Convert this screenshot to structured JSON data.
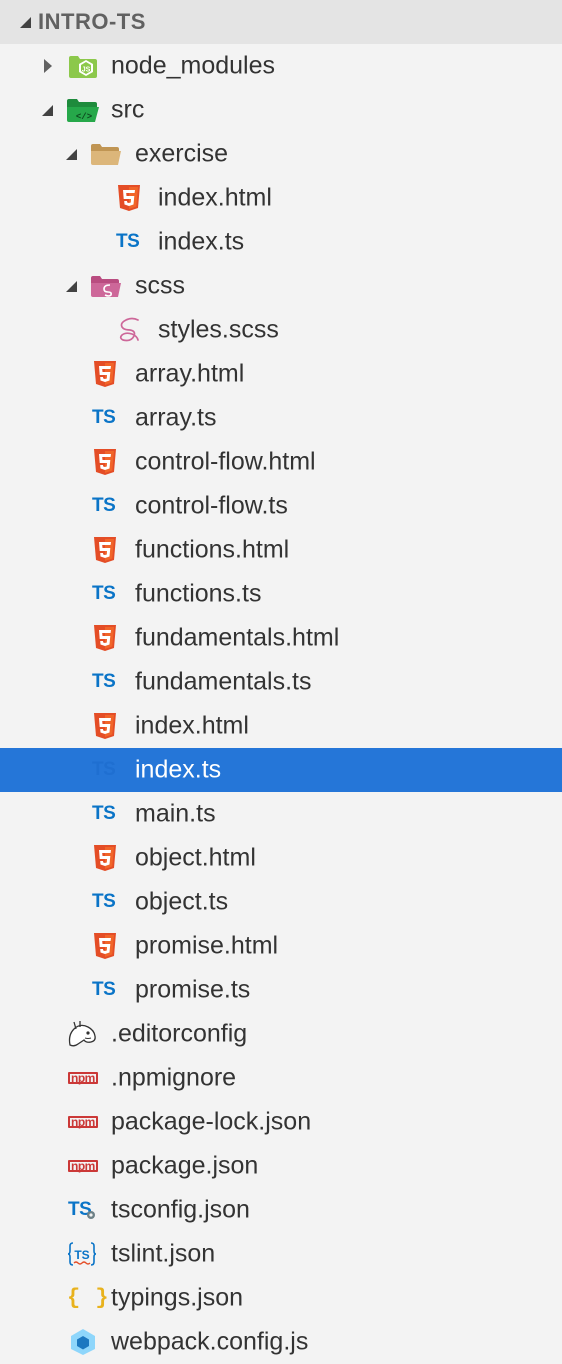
{
  "explorer": {
    "section_title": "INTRO-TS",
    "items": [
      {
        "label": "node_modules",
        "icon": "node-folder-icon",
        "type": "folder",
        "expanded": false
      },
      {
        "label": "src",
        "icon": "src-folder-icon",
        "type": "folder",
        "expanded": true
      },
      {
        "label": "exercise",
        "icon": "folder-open-icon",
        "type": "folder",
        "expanded": true
      },
      {
        "label": "index.html",
        "icon": "html5-icon",
        "type": "file"
      },
      {
        "label": "index.ts",
        "icon": "typescript-icon",
        "type": "file"
      },
      {
        "label": "scss",
        "icon": "sass-folder-icon",
        "type": "folder",
        "expanded": true
      },
      {
        "label": "styles.scss",
        "icon": "sass-icon",
        "type": "file"
      },
      {
        "label": "array.html",
        "icon": "html5-icon",
        "type": "file"
      },
      {
        "label": "array.ts",
        "icon": "typescript-icon",
        "type": "file"
      },
      {
        "label": "control-flow.html",
        "icon": "html5-icon",
        "type": "file"
      },
      {
        "label": "control-flow.ts",
        "icon": "typescript-icon",
        "type": "file"
      },
      {
        "label": "functions.html",
        "icon": "html5-icon",
        "type": "file"
      },
      {
        "label": "functions.ts",
        "icon": "typescript-icon",
        "type": "file"
      },
      {
        "label": "fundamentals.html",
        "icon": "html5-icon",
        "type": "file"
      },
      {
        "label": "fundamentals.ts",
        "icon": "typescript-icon",
        "type": "file"
      },
      {
        "label": "index.html",
        "icon": "html5-icon",
        "type": "file"
      },
      {
        "label": "index.ts",
        "icon": "typescript-icon",
        "type": "file",
        "selected": true
      },
      {
        "label": "main.ts",
        "icon": "typescript-icon",
        "type": "file"
      },
      {
        "label": "object.html",
        "icon": "html5-icon",
        "type": "file"
      },
      {
        "label": "object.ts",
        "icon": "typescript-icon",
        "type": "file"
      },
      {
        "label": "promise.html",
        "icon": "html5-icon",
        "type": "file"
      },
      {
        "label": "promise.ts",
        "icon": "typescript-icon",
        "type": "file"
      },
      {
        "label": ".editorconfig",
        "icon": "editorconfig-icon",
        "type": "file"
      },
      {
        "label": ".npmignore",
        "icon": "npm-icon",
        "type": "file"
      },
      {
        "label": "package-lock.json",
        "icon": "npm-icon",
        "type": "file"
      },
      {
        "label": "package.json",
        "icon": "npm-icon",
        "type": "file"
      },
      {
        "label": "tsconfig.json",
        "icon": "tsconfig-icon",
        "type": "file"
      },
      {
        "label": "tslint.json",
        "icon": "tslint-icon",
        "type": "file"
      },
      {
        "label": "typings.json",
        "icon": "json-braces-icon",
        "type": "file"
      },
      {
        "label": "webpack.config.js",
        "icon": "webpack-icon",
        "type": "file"
      }
    ]
  },
  "icon_text": {
    "ts": "TS",
    "npm": "npm",
    "braces": "{ }",
    "nodejs": "JS"
  },
  "colors": {
    "background": "#f3f3f3",
    "header_background": "#e4e4e4",
    "selection": "#2576d8",
    "html5": "#e44d26",
    "typescript": "#0a74c7",
    "sass": "#cd6799",
    "npm": "#cb3837",
    "node_green": "#8cc84b",
    "src_green": "#1e8b3c",
    "folder_tan": "#dcb67a",
    "json_yellow": "#e8b21d",
    "webpack_blue": "#8ed6fb"
  }
}
